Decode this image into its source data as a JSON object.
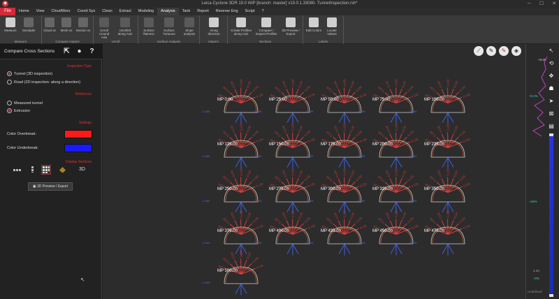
{
  "window": {
    "title": "Leica Cyclone 3DR 19.0 WiP [branch: master] v19.0.1.33080- TunnelInspection.rsh*",
    "logo": "cyclone-3dr-logo"
  },
  "menu": {
    "file": "File",
    "tabs": [
      "Home",
      "View",
      "CloudWorx",
      "Coord Sys",
      "Clean",
      "Extract",
      "Modeling",
      "Analysis",
      "Tank",
      "Report",
      "Reverse Eng",
      "Script",
      "?"
    ],
    "active": "Analysis"
  },
  "ribbon": {
    "groups": [
      {
        "label": "Measure",
        "buttons": [
          "Measure",
          "Stockpile"
        ]
      },
      {
        "label": "Compare Inspect",
        "buttons": [
          "Cloud vs",
          "Mesh vs",
          "Section vs"
        ]
      },
      {
        "label": "Unroll",
        "buttons": [
          "Unroll Around Axis",
          "Unrolled along Axis"
        ]
      },
      {
        "label": "Surface Analysis",
        "buttons": [
          "Surface flatness",
          "Surface Tortuous",
          "Slope analysis"
        ]
      },
      {
        "label": "Inspect",
        "buttons": [
          "Along direction"
        ]
      },
      {
        "label": "Sections",
        "buttons": [
          "Create Profiles along Axis",
          "Compare / Inspect Profiles",
          "3D Preview / Export"
        ]
      },
      {
        "label": "Labels",
        "buttons": [
          "Edit Colors",
          "Locate Values"
        ]
      }
    ]
  },
  "panel": {
    "title": "Compare Cross Sections",
    "inspection_type": {
      "title": "Inspection Type",
      "options": [
        "Tunnel (3D inspection)",
        "Road (2D inspection: along a direction)"
      ],
      "selected": 0
    },
    "reference": {
      "title": "Reference",
      "options": [
        "Measured tunnel",
        "Extrusion"
      ],
      "selected": 1
    },
    "settings": {
      "title": "Settings",
      "overbreak_label": "Color Overbreak:",
      "overbreak_color": "#ff1a1a",
      "underbreak_label": "Color Underbreak:",
      "underbreak_color": "#1a1aff"
    },
    "display": {
      "title": "Display Sections",
      "mode_3d": "3D",
      "preview_button": "3D Preview / Export"
    }
  },
  "viewport": {
    "tools": [
      "scale-icon",
      "measure-icon",
      "measure-red-icon",
      "label-icon"
    ],
    "sections": [
      [
        "MP 0.00",
        "MP 25.00",
        "MP 50.00",
        "MP 75.00",
        "MP 100.00"
      ],
      [
        "MP 125.00",
        "MP 150.00",
        "MP 175.00",
        "MP 200.00",
        "MP 225.00"
      ],
      [
        "MP 250.00",
        "MP 275.00",
        "MP 300.00",
        "MP 325.00",
        "MP 350.00"
      ],
      [
        "MP 375.00",
        "MP 400.00",
        "MP 425.00",
        "MP 450.00",
        "MP 475.00"
      ],
      [
        "MP 500.00"
      ]
    ],
    "deviation_sample": "-0.399"
  },
  "colorbar": {
    "top_value": "+0.26",
    "upper_value": "+0.2%",
    "mid_value": "+18%",
    "lower_value": "1.23",
    "bottom_value": "+0%",
    "undefined_label": "Undefined"
  }
}
